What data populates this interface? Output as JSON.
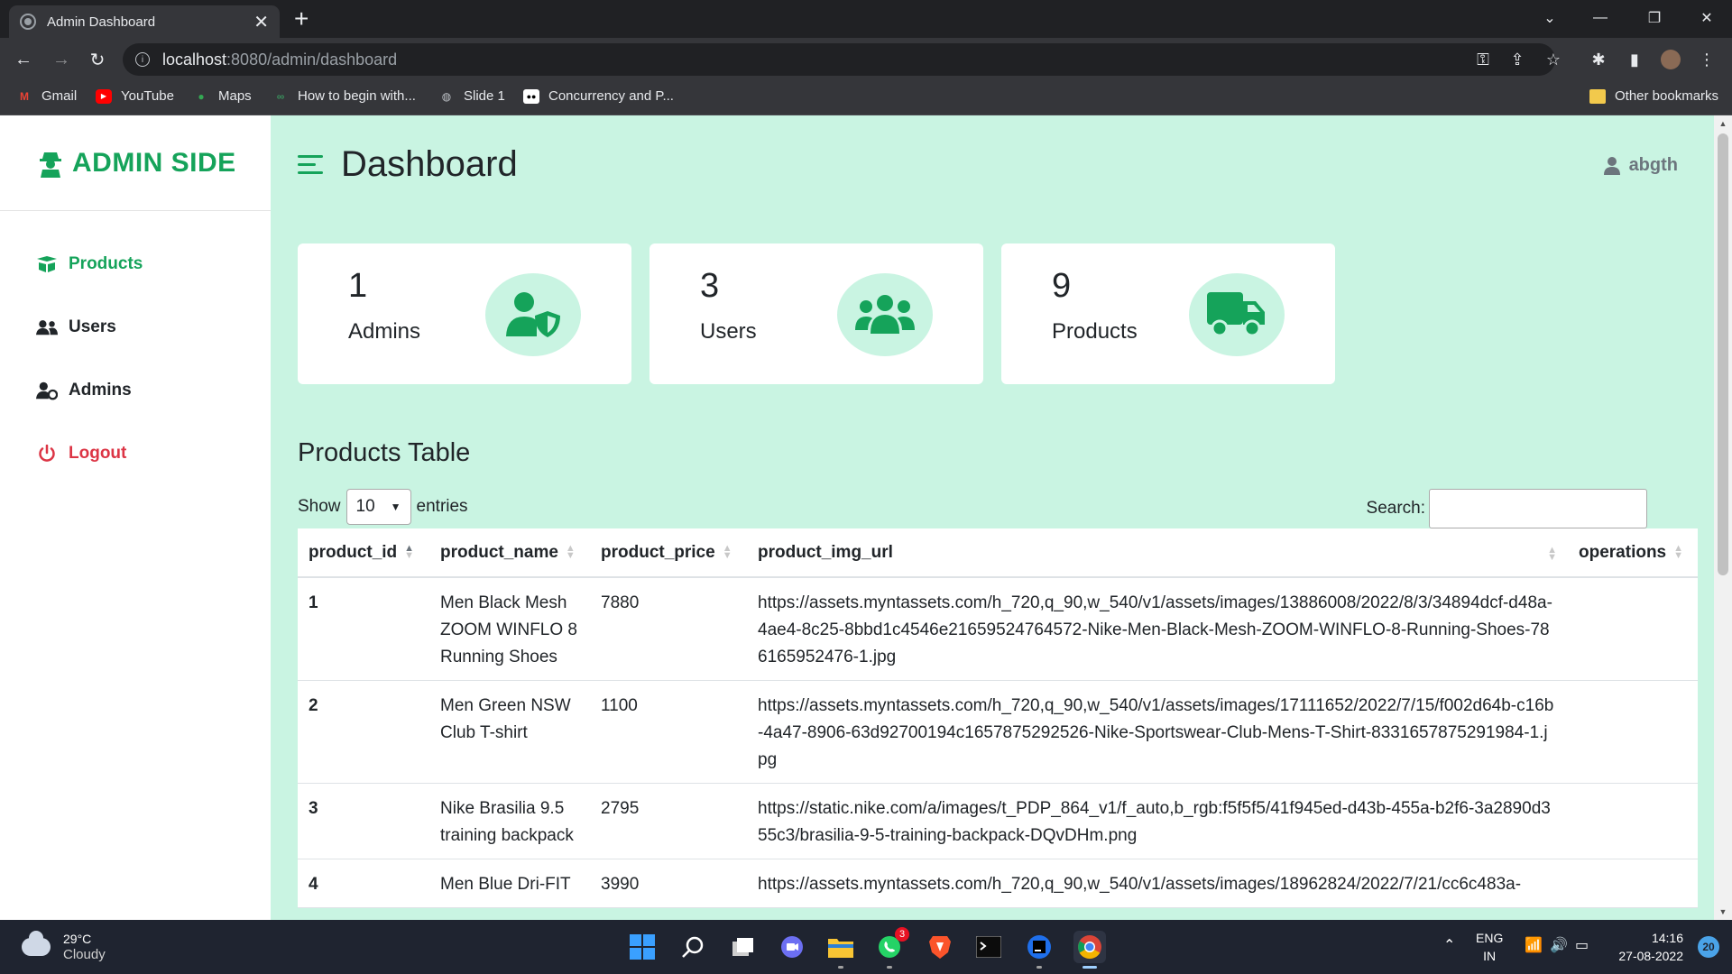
{
  "browser": {
    "tab_title": "Admin Dashboard",
    "url_host": "localhost",
    "url_path": ":8080/admin/dashboard",
    "bookmarks": [
      "Gmail",
      "YouTube",
      "Maps",
      "How to begin with...",
      "Slide 1",
      "Concurrency and P..."
    ],
    "other_bookmarks": "Other bookmarks"
  },
  "sidebar": {
    "brand": "ADMIN SIDE",
    "items": [
      {
        "label": "Products",
        "icon": "box-open-icon"
      },
      {
        "label": "Users",
        "icon": "users-icon"
      },
      {
        "label": "Admins",
        "icon": "user-gear-icon"
      },
      {
        "label": "Logout",
        "icon": "power-icon"
      }
    ]
  },
  "header": {
    "title": "Dashboard",
    "username": "abgth"
  },
  "cards": [
    {
      "count": "1",
      "label": "Admins",
      "icon": "user-shield-icon"
    },
    {
      "count": "3",
      "label": "Users",
      "icon": "users-icon"
    },
    {
      "count": "9",
      "label": "Products",
      "icon": "truck-icon"
    }
  ],
  "table": {
    "title": "Products Table",
    "show_label": "Show",
    "page_size": "10",
    "entries_label": "entries",
    "search_label": "Search:",
    "columns": [
      "product_id",
      "product_name",
      "product_price",
      "product_img_url",
      "operations"
    ],
    "rows": [
      {
        "id": "1",
        "name": "Men Black Mesh ZOOM WINFLO 8 Running Shoes",
        "price": "7880",
        "url": "https://assets.myntassets.com/h_720,q_90,w_540/v1/assets/images/13886008/2022/8/3/34894dcf-d48a-4ae4-8c25-8bbd1c4546e21659524764572-Nike-Men-Black-Mesh-ZOOM-WINFLO-8-Running-Shoes-786165952476-1.jpg"
      },
      {
        "id": "2",
        "name": "Men Green NSW Club T-shirt",
        "price": "1100",
        "url": "https://assets.myntassets.com/h_720,q_90,w_540/v1/assets/images/17111652/2022/7/15/f002d64b-c16b-4a47-8906-63d92700194c1657875292526-Nike-Sportswear-Club-Mens-T-Shirt-8331657875291984-1.jpg"
      },
      {
        "id": "3",
        "name": "Nike Brasilia 9.5 training backpack",
        "price": "2795",
        "url": "https://static.nike.com/a/images/t_PDP_864_v1/f_auto,b_rgb:f5f5f5/41f945ed-d43b-455a-b2f6-3a2890d355c3/brasilia-9-5-training-backpack-DQvDHm.png"
      },
      {
        "id": "4",
        "name": "Men Blue Dri-FIT",
        "price": "3990",
        "url": "https://assets.myntassets.com/h_720,q_90,w_540/v1/assets/images/18962824/2022/7/21/cc6c483a-"
      }
    ]
  },
  "taskbar": {
    "temperature": "29°C",
    "weather": "Cloudy",
    "whatsapp_badge": "3",
    "lang": "ENG",
    "region": "IN",
    "time": "14:16",
    "date": "27-08-2022",
    "notifications": "20"
  },
  "colors": {
    "accent": "#15a35a",
    "page_bg": "#c9f4e2",
    "logout": "#dc3545"
  }
}
